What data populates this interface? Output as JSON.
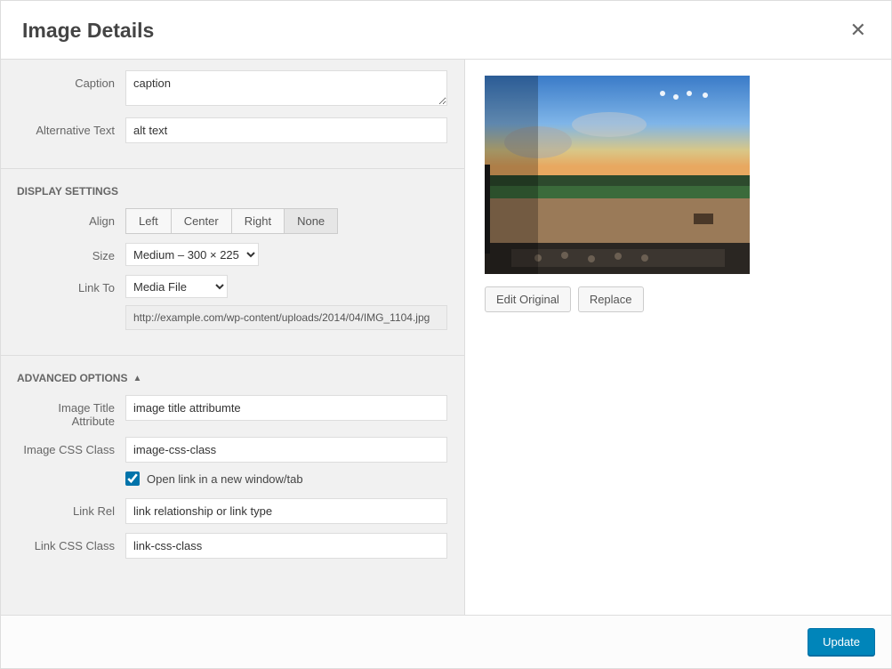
{
  "title": "Image Details",
  "fields": {
    "caption_label": "Caption",
    "caption_value": "caption",
    "alt_label": "Alternative Text",
    "alt_value": "alt text"
  },
  "display": {
    "section_title": "DISPLAY SETTINGS",
    "align_label": "Align",
    "align_options": {
      "left": "Left",
      "center": "Center",
      "right": "Right",
      "none": "None"
    },
    "align_active": "none",
    "size_label": "Size",
    "size_value": "Medium – 300 × 225",
    "linkto_label": "Link To",
    "linkto_value": "Media File",
    "url_value": "http://example.com/wp-content/uploads/2014/04/IMG_1104.jpg"
  },
  "advanced": {
    "section_title": "ADVANCED OPTIONS",
    "title_attr_label": "Image Title Attribute",
    "title_attr_value": "image title attribumte",
    "css_class_label": "Image CSS Class",
    "css_class_value": "image-css-class",
    "open_new_tab_label": "Open link in a new window/tab",
    "open_new_tab_checked": true,
    "link_rel_label": "Link Rel",
    "link_rel_value": "link relationship or link type",
    "link_css_label": "Link CSS Class",
    "link_css_value": "link-css-class"
  },
  "preview": {
    "edit_label": "Edit Original",
    "replace_label": "Replace"
  },
  "footer": {
    "update_label": "Update"
  }
}
